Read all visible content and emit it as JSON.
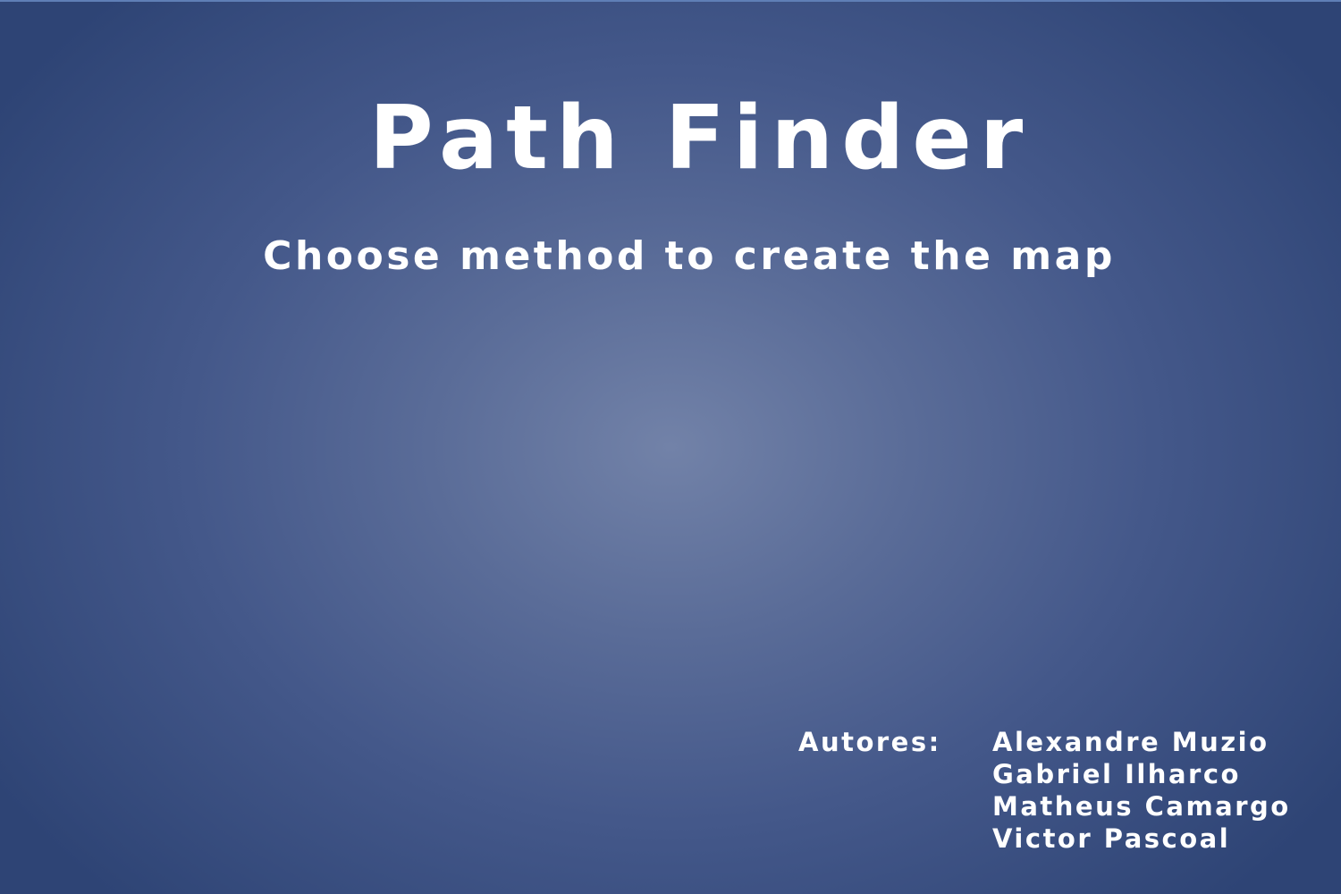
{
  "title": "Path Finder",
  "subtitle": "Choose method to create the map",
  "credits": {
    "label": "Autores:",
    "authors": [
      "Alexandre Muzio",
      "Gabriel Ilharco",
      "Matheus Camargo",
      "Victor Pascoal"
    ]
  },
  "colors": {
    "background_center": "#7282a8",
    "background_edge": "#2e4475",
    "text": "#ffffff"
  }
}
